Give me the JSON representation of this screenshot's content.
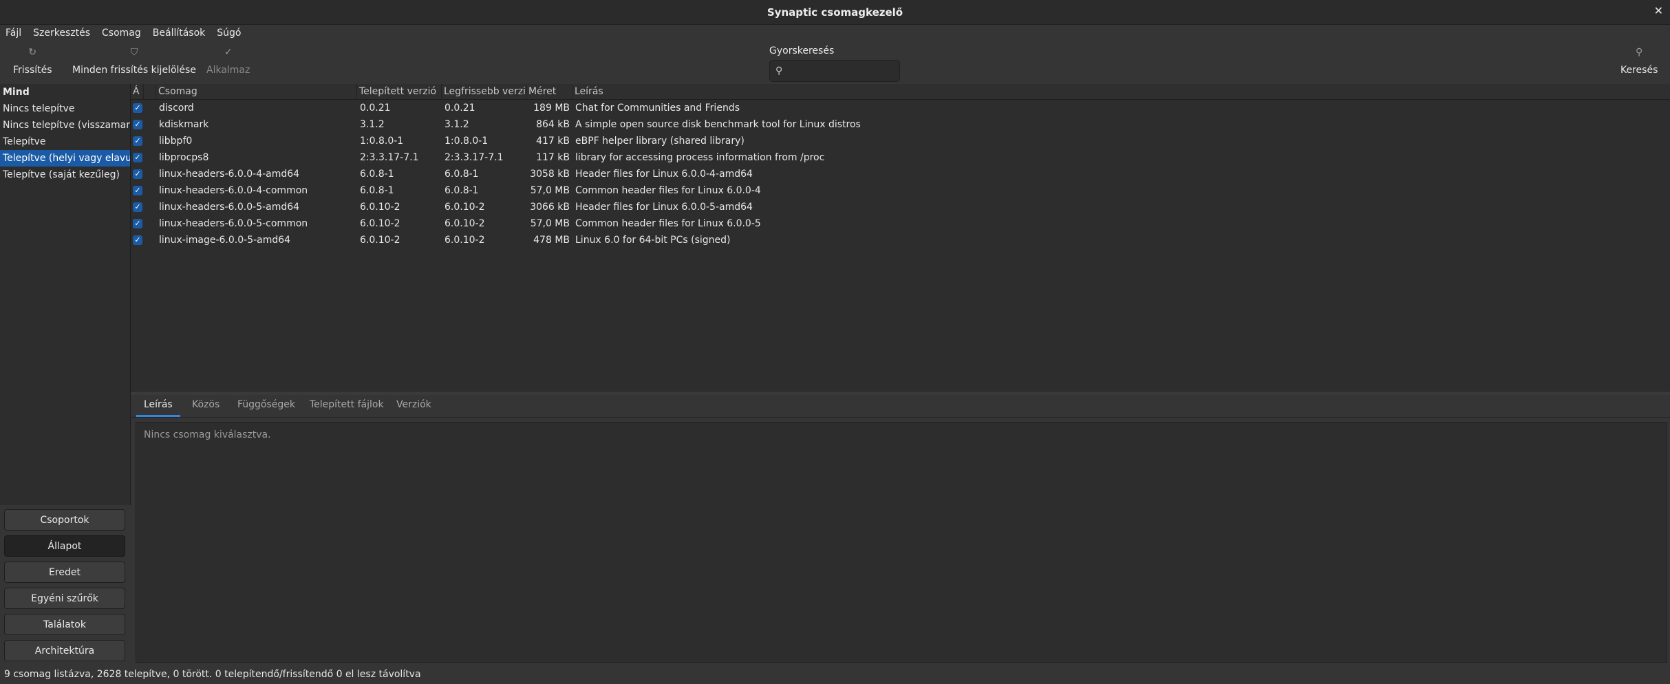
{
  "window": {
    "title": "Synaptic csomagkezelő"
  },
  "menu": [
    "Fájl",
    "Szerkesztés",
    "Csomag",
    "Beállítások",
    "Súgó"
  ],
  "toolbar": {
    "refresh": "Frissítés",
    "mark_all_upgrades": "Minden frissítés kijelölése",
    "apply": "Alkalmaz",
    "quick_search_label": "Gyorskeresés",
    "quick_search_value": "",
    "search": "Keresés"
  },
  "sidebar": {
    "items": [
      "Mind",
      "Nincs telepítve",
      "Nincs telepítve (visszamaradt",
      "Telepítve",
      "Telepítve (helyi vagy elavult)",
      "Telepítve (saját kezűleg)"
    ],
    "buttons": [
      "Csoportok",
      "Állapot",
      "Eredet",
      "Egyéni szűrők",
      "Találatok",
      "Architektúra"
    ]
  },
  "table": {
    "headers": {
      "status": "Á",
      "package": "Csomag",
      "installed": "Telepített verzió",
      "latest": "Legfrissebb verzió",
      "size": "Méret",
      "description": "Leírás"
    },
    "rows": [
      {
        "name": "discord",
        "installed": "0.0.21",
        "latest": "0.0.21",
        "size": "189 MB",
        "desc": "Chat for Communities and Friends"
      },
      {
        "name": "kdiskmark",
        "installed": "3.1.2",
        "latest": "3.1.2",
        "size": "864 kB",
        "desc": "A simple open source disk benchmark tool for Linux distros"
      },
      {
        "name": "libbpf0",
        "installed": "1:0.8.0-1",
        "latest": "1:0.8.0-1",
        "size": "417 kB",
        "desc": "eBPF helper library (shared library)"
      },
      {
        "name": "libprocps8",
        "installed": "2:3.3.17-7.1",
        "latest": "2:3.3.17-7.1",
        "size": "117 kB",
        "desc": "library for accessing process information from /proc"
      },
      {
        "name": "linux-headers-6.0.0-4-amd64",
        "installed": "6.0.8-1",
        "latest": "6.0.8-1",
        "size": "3058 kB",
        "desc": "Header files for Linux 6.0.0-4-amd64"
      },
      {
        "name": "linux-headers-6.0.0-4-common",
        "installed": "6.0.8-1",
        "latest": "6.0.8-1",
        "size": "57,0 MB",
        "desc": "Common header files for Linux 6.0.0-4"
      },
      {
        "name": "linux-headers-6.0.0-5-amd64",
        "installed": "6.0.10-2",
        "latest": "6.0.10-2",
        "size": "3066 kB",
        "desc": "Header files for Linux 6.0.0-5-amd64"
      },
      {
        "name": "linux-headers-6.0.0-5-common",
        "installed": "6.0.10-2",
        "latest": "6.0.10-2",
        "size": "57,0 MB",
        "desc": "Common header files for Linux 6.0.0-5"
      },
      {
        "name": "linux-image-6.0.0-5-amd64",
        "installed": "6.0.10-2",
        "latest": "6.0.10-2",
        "size": "478 MB",
        "desc": "Linux 6.0 for 64-bit PCs (signed)"
      }
    ]
  },
  "tabs": [
    "Leírás",
    "Közös",
    "Függőségek",
    "Telepített fájlok",
    "Verziók"
  ],
  "details": {
    "message": "Nincs csomag kiválasztva."
  },
  "status": "9 csomag listázva, 2628 telepítve, 0 törött. 0 telepítendő/frissítendő 0 el lesz távolítva",
  "colors": {
    "accent": "#3584e4",
    "selection": "#1b5ba6"
  }
}
